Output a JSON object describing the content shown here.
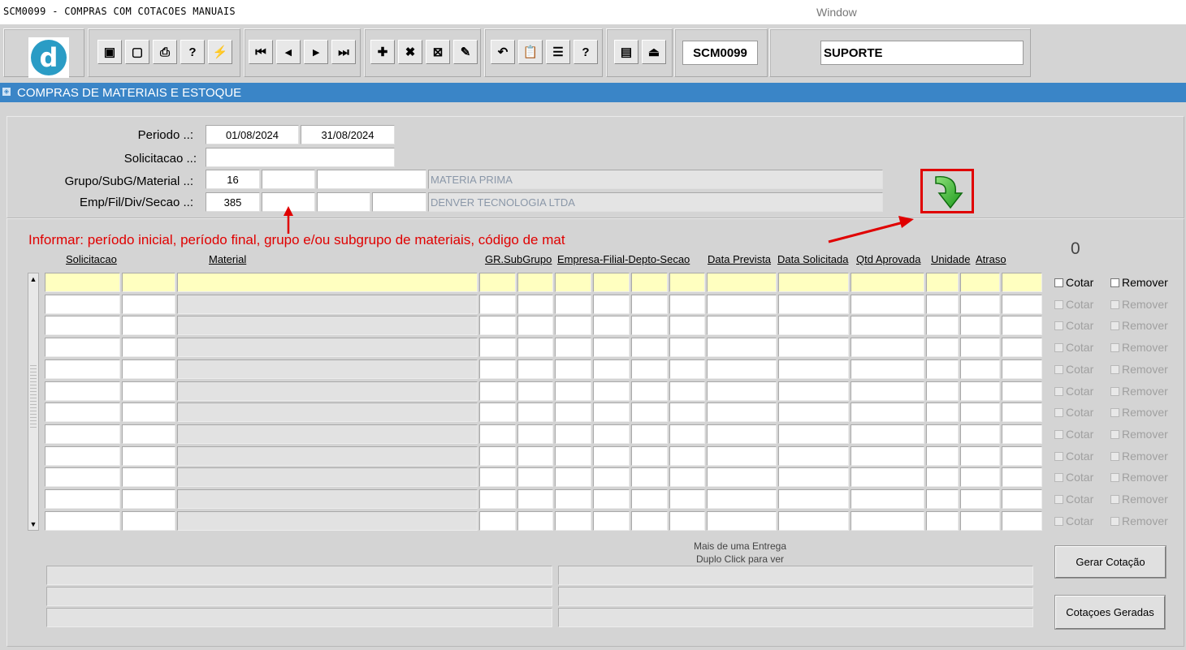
{
  "window": {
    "title": "SCM0099 - COMPRAS COM COTACOES MANUAIS",
    "menu_window": "Window"
  },
  "toolbar": {
    "logo_letter": "d",
    "form_code": "SCM0099",
    "user": "SUPORTE",
    "buttons": [
      {
        "icon": "save-icon",
        "glyph": "▣"
      },
      {
        "icon": "window-icon",
        "glyph": "▢"
      },
      {
        "icon": "print-icon",
        "glyph": "⎙"
      },
      {
        "icon": "query-icon",
        "glyph": "?"
      },
      {
        "icon": "execute-query-icon",
        "glyph": "⚡"
      },
      {
        "icon": "first-record-icon",
        "glyph": "⏮"
      },
      {
        "icon": "previous-record-icon",
        "glyph": "◂"
      },
      {
        "icon": "next-record-icon",
        "glyph": "▸"
      },
      {
        "icon": "last-record-icon",
        "glyph": "⏭"
      },
      {
        "icon": "insert-record-icon",
        "glyph": "✚"
      },
      {
        "icon": "delete-record-icon",
        "glyph": "✖"
      },
      {
        "icon": "clear-record-icon",
        "glyph": "⊠"
      },
      {
        "icon": "edit-icon",
        "glyph": "✎"
      },
      {
        "icon": "undo-icon",
        "glyph": "↶"
      },
      {
        "icon": "clipboard-icon",
        "glyph": "📋"
      },
      {
        "icon": "list-values-icon",
        "glyph": "☰"
      },
      {
        "icon": "help-icon",
        "glyph": "?"
      },
      {
        "icon": "menu-icon",
        "glyph": "▤"
      },
      {
        "icon": "exit-icon",
        "glyph": "⏏"
      }
    ]
  },
  "module": {
    "title": "COMPRAS DE MATERIAIS E ESTOQUE"
  },
  "filters": {
    "periodo_label": "Periodo ..:",
    "periodo_inicio": "01/08/2024",
    "periodo_fim": "31/08/2024",
    "solicitacao_label": "Solicitacao ..:",
    "solicitacao_value": "",
    "grupo_label": "Grupo/SubG/Material ..:",
    "grupo_value": "16",
    "subgrupo_value": "",
    "material_value": "",
    "grupo_desc": "MATERIA PRIMA",
    "emp_label": "Emp/Fil/Div/Secao  ..:",
    "emp_value": "385",
    "fil_value": "",
    "div_value": "",
    "secao_value": "",
    "emp_desc": "DENVER TECNOLOGIA LTDA"
  },
  "annotation": "Informar: período inicial, período final, grupo e/ou subgrupo de materiais, código de mat",
  "record_count": "0",
  "grid": {
    "headers": {
      "solicitacao": "Solicitacao",
      "material": "Material",
      "gr_subgrupo": "GR.SubGrupo",
      "empresa": "Empresa-Filial-Depto-Secao",
      "data_prevista": "Data Prevista",
      "data_solicitada": "Data Solicitada",
      "qtd_aprovada": "Qtd Aprovada",
      "unidade": "Unidade",
      "atraso": "Atraso"
    },
    "row_count": 12,
    "cotar_label": "Cotar",
    "remover_label": "Remover"
  },
  "footer": {
    "hint_line1": "Mais de uma Entrega",
    "hint_line2": "Duplo Click para ver",
    "gerar_cotacao": "Gerar Cotação",
    "cotacoes_geradas": "Cotaçoes Geradas"
  }
}
